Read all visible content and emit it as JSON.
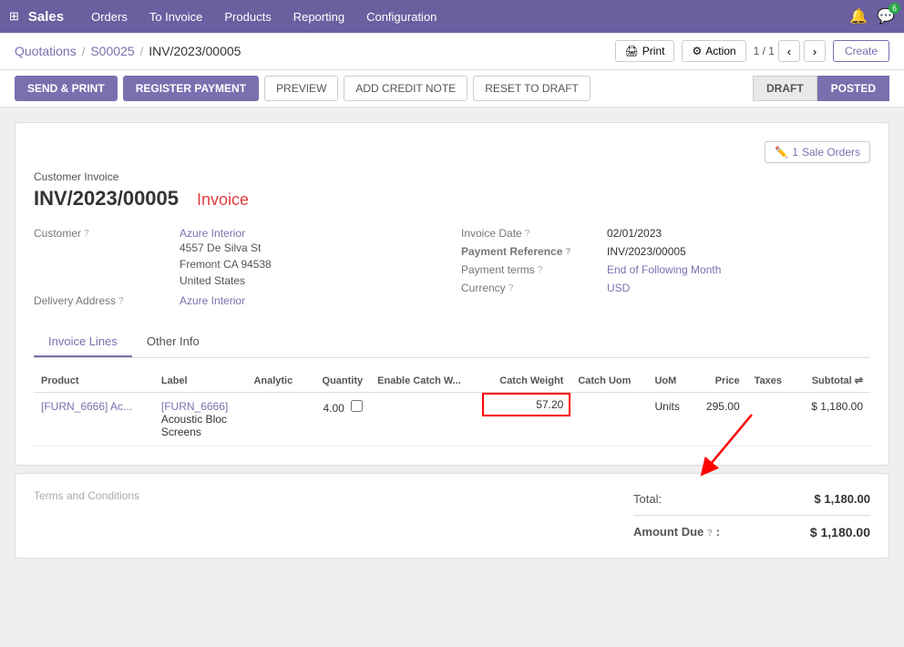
{
  "app": {
    "name": "Sales",
    "nav_items": [
      "Orders",
      "To Invoice",
      "Products",
      "Reporting",
      "Configuration"
    ]
  },
  "breadcrumb": {
    "links": [
      "Quotations",
      "S00025"
    ],
    "current": "INV/2023/00005"
  },
  "toolbar": {
    "print_label": "Print",
    "action_label": "Action",
    "page_info": "1 / 1",
    "create_label": "Create",
    "send_print_label": "SEND & PRINT",
    "register_payment_label": "REGISTER PAYMENT",
    "preview_label": "PREVIEW",
    "add_credit_label": "ADD CREDIT NOTE",
    "reset_label": "RESET TO DRAFT",
    "status_draft": "DRAFT",
    "status_posted": "POSTED"
  },
  "sale_orders_btn": {
    "count": "1",
    "label": "Sale Orders"
  },
  "invoice": {
    "doc_type": "Customer Invoice",
    "doc_number": "INV/2023/00005",
    "doc_label": "Invoice",
    "customer_label": "Customer",
    "customer_name": "Azure Interior",
    "customer_address": "4557 De Silva St\nFremont CA 94538\nUnited States",
    "delivery_address_label": "Delivery Address",
    "delivery_address": "Azure Interior",
    "invoice_date_label": "Invoice Date",
    "invoice_date": "02/01/2023",
    "payment_ref_label": "Payment Reference",
    "payment_ref": "INV/2023/00005",
    "payment_terms_label": "Payment terms",
    "payment_terms": "End of Following Month",
    "currency_label": "Currency",
    "currency": "USD"
  },
  "tabs": [
    {
      "id": "invoice-lines",
      "label": "Invoice Lines",
      "active": true
    },
    {
      "id": "other-info",
      "label": "Other Info",
      "active": false
    }
  ],
  "table": {
    "headers": [
      "Product",
      "Label",
      "Analytic",
      "Quantity",
      "Enable Catch W...",
      "Catch Weight",
      "Catch Uom",
      "UoM",
      "Price",
      "Taxes",
      "Subtotal"
    ],
    "rows": [
      {
        "product": "[FURN_6666] Ac...",
        "label_line1": "[FURN_6666]",
        "label_line2": "Acoustic Bloc",
        "label_line3": "Screens",
        "analytic": "",
        "quantity": "4.00",
        "enable_catch": false,
        "catch_weight": "57.20",
        "catch_uom": "",
        "uom": "Units",
        "price": "295.00",
        "taxes": "",
        "subtotal": "$ 1,180.00"
      }
    ]
  },
  "totals": {
    "terms_label": "Terms and Conditions",
    "total_label": "Total:",
    "total_value": "$ 1,180.00",
    "amount_due_label": "Amount Due",
    "amount_due_value": "$ 1,180.00"
  }
}
